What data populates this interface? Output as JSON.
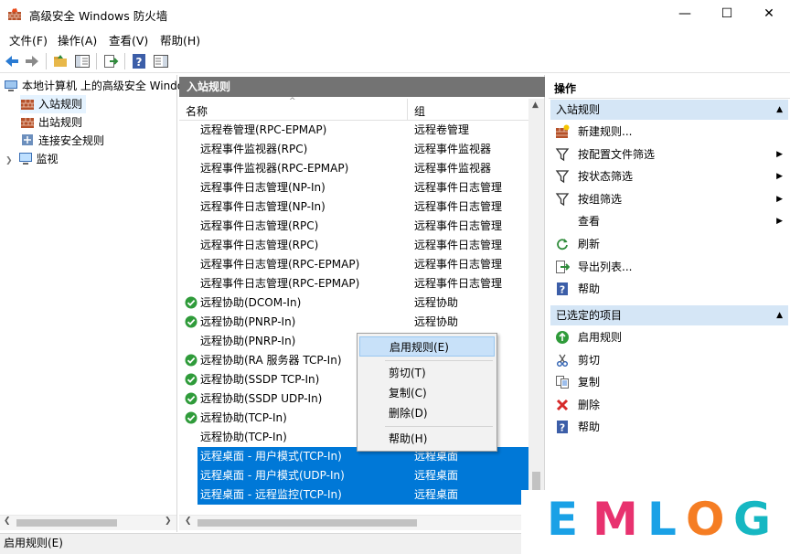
{
  "window": {
    "title": "高级安全 Windows 防火墙",
    "minimize": "—",
    "maximize": "☐",
    "close": "✕"
  },
  "menu": [
    "文件(F)",
    "操作(A)",
    "查看(V)",
    "帮助(H)"
  ],
  "tree": {
    "root": "本地计算机 上的高级安全 Windows",
    "items": [
      "入站规则",
      "出站规则",
      "连接安全规则",
      "监视"
    ]
  },
  "center": {
    "header": "入站规则",
    "col_name": "名称",
    "col_group": "组",
    "rows": [
      {
        "name": "远程卷管理(RPC-EPMAP)",
        "group": "远程卷管理",
        "enabled": false,
        "selected": false
      },
      {
        "name": "远程事件监视器(RPC)",
        "group": "远程事件监视器",
        "enabled": false,
        "selected": false
      },
      {
        "name": "远程事件监视器(RPC-EPMAP)",
        "group": "远程事件监视器",
        "enabled": false,
        "selected": false
      },
      {
        "name": "远程事件日志管理(NP-In)",
        "group": "远程事件日志管理",
        "enabled": false,
        "selected": false
      },
      {
        "name": "远程事件日志管理(NP-In)",
        "group": "远程事件日志管理",
        "enabled": false,
        "selected": false
      },
      {
        "name": "远程事件日志管理(RPC)",
        "group": "远程事件日志管理",
        "enabled": false,
        "selected": false
      },
      {
        "name": "远程事件日志管理(RPC)",
        "group": "远程事件日志管理",
        "enabled": false,
        "selected": false
      },
      {
        "name": "远程事件日志管理(RPC-EPMAP)",
        "group": "远程事件日志管理",
        "enabled": false,
        "selected": false
      },
      {
        "name": "远程事件日志管理(RPC-EPMAP)",
        "group": "远程事件日志管理",
        "enabled": false,
        "selected": false
      },
      {
        "name": "远程协助(DCOM-In)",
        "group": "远程协助",
        "enabled": true,
        "selected": false
      },
      {
        "name": "远程协助(PNRP-In)",
        "group": "远程协助",
        "enabled": true,
        "selected": false
      },
      {
        "name": "远程协助(PNRP-In)",
        "group": "",
        "enabled": false,
        "selected": false
      },
      {
        "name": "远程协助(RA 服务器 TCP-In)",
        "group": "",
        "enabled": true,
        "selected": false
      },
      {
        "name": "远程协助(SSDP TCP-In)",
        "group": "",
        "enabled": true,
        "selected": false
      },
      {
        "name": "远程协助(SSDP UDP-In)",
        "group": "",
        "enabled": true,
        "selected": false
      },
      {
        "name": "远程协助(TCP-In)",
        "group": "",
        "enabled": true,
        "selected": false
      },
      {
        "name": "远程协助(TCP-In)",
        "group": "",
        "enabled": false,
        "selected": false
      },
      {
        "name": "远程桌面 - 用户模式(TCP-In)",
        "group": "远程桌面",
        "enabled": false,
        "selected": true
      },
      {
        "name": "远程桌面 - 用户模式(UDP-In)",
        "group": "远程桌面",
        "enabled": false,
        "selected": true
      },
      {
        "name": "远程桌面 - 远程监控(TCP-In)",
        "group": "远程桌面",
        "enabled": false,
        "selected": true
      }
    ]
  },
  "context_menu": {
    "enable": "启用规则(E)",
    "cut": "剪切(T)",
    "copy": "复制(C)",
    "delete": "删除(D)",
    "help": "帮助(H)"
  },
  "actions": {
    "header": "操作",
    "section1": "入站规则",
    "items1": [
      {
        "label": "新建规则...",
        "icon": "new-rule-icon",
        "submenu": false
      },
      {
        "label": "按配置文件筛选",
        "icon": "filter-icon",
        "submenu": true
      },
      {
        "label": "按状态筛选",
        "icon": "filter-icon",
        "submenu": true
      },
      {
        "label": "按组筛选",
        "icon": "filter-icon",
        "submenu": true
      },
      {
        "label": "查看",
        "icon": "",
        "submenu": true
      },
      {
        "label": "刷新",
        "icon": "refresh-icon",
        "submenu": false
      },
      {
        "label": "导出列表...",
        "icon": "export-icon",
        "submenu": false
      },
      {
        "label": "帮助",
        "icon": "help-icon",
        "submenu": false
      }
    ],
    "section2": "已选定的项目",
    "items2": [
      {
        "label": "启用规则",
        "icon": "enable-icon"
      },
      {
        "label": "剪切",
        "icon": "cut-icon"
      },
      {
        "label": "复制",
        "icon": "copy-icon"
      },
      {
        "label": "删除",
        "icon": "delete-icon"
      },
      {
        "label": "帮助",
        "icon": "help-icon"
      }
    ]
  },
  "status": "启用规则(E)",
  "logo": {
    "letters": [
      "E",
      "M",
      "L",
      "O",
      "G"
    ],
    "colors": [
      "#1aa1e6",
      "#e8326f",
      "#1aa1e6",
      "#f57d23",
      "#16b7c2"
    ]
  }
}
